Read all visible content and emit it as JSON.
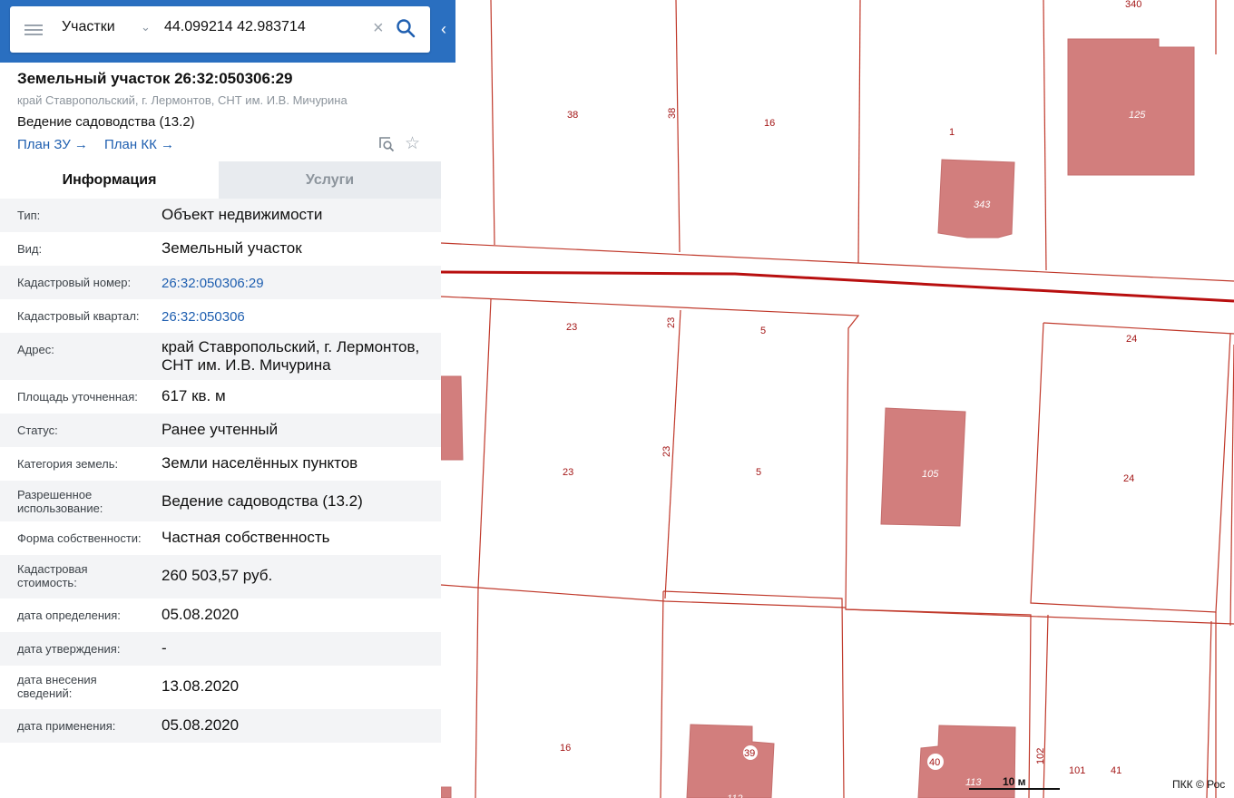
{
  "search": {
    "layer": "Участки",
    "coordinates": "44.099214 42.983714"
  },
  "parcel": {
    "title": "Земельный участок 26:32:050306:29",
    "address": "край Ставропольский, г. Лермонтов, СНТ им. И.В. Мичурина",
    "usage": "Ведение садоводства (13.2)",
    "plan_zu": "План ЗУ",
    "plan_kk": "План КК"
  },
  "tabs": {
    "info": "Информация",
    "services": "Услуги"
  },
  "info_rows": [
    {
      "label": "Тип:",
      "value": "Объект недвижимости"
    },
    {
      "label": "Вид:",
      "value": "Земельный участок"
    },
    {
      "label": "Кадастровый номер:",
      "value": "26:32:050306:29"
    },
    {
      "label": "Кадастровый квартал:",
      "value": "26:32:050306"
    },
    {
      "label": "Адрес:",
      "value": "край Ставропольский, г. Лермонтов, СНТ им. И.В. Мичурина"
    },
    {
      "label": "Площадь уточненная:",
      "value": "617 кв. м"
    },
    {
      "label": "Статус:",
      "value": "Ранее учтенный"
    },
    {
      "label": "Категория земель:",
      "value": "Земли населённых пунктов"
    },
    {
      "label": "Разрешенное использование:",
      "value": "Ведение садоводства (13.2)"
    },
    {
      "label": "Форма собственности:",
      "value": "Частная собственность"
    },
    {
      "label": "Кадастровая стоимость:",
      "value": "260 503,57 руб."
    },
    {
      "label": "дата определения:",
      "value": "05.08.2020"
    },
    {
      "label": "дата утверждения:",
      "value": "-"
    },
    {
      "label": "дата внесения сведений:",
      "value": "13.08.2020"
    },
    {
      "label": "дата применения:",
      "value": "05.08.2020"
    }
  ],
  "map": {
    "parcel_labels": [
      "340",
      "38",
      "38",
      "16",
      "1",
      "23",
      "23",
      "5",
      "24",
      "23",
      "23",
      "5",
      "24",
      "16",
      "102",
      "101",
      "41"
    ],
    "building_labels": [
      "125",
      "343",
      "105",
      "39",
      "40",
      "113",
      "112"
    ],
    "scale": "10 м",
    "attribution": "ПКК © Рос"
  },
  "colors": {
    "header": "#2a6fc0",
    "link": "#1f5fb0",
    "parcel_line": "#c0392b",
    "building_fill": "#d27e7d"
  }
}
